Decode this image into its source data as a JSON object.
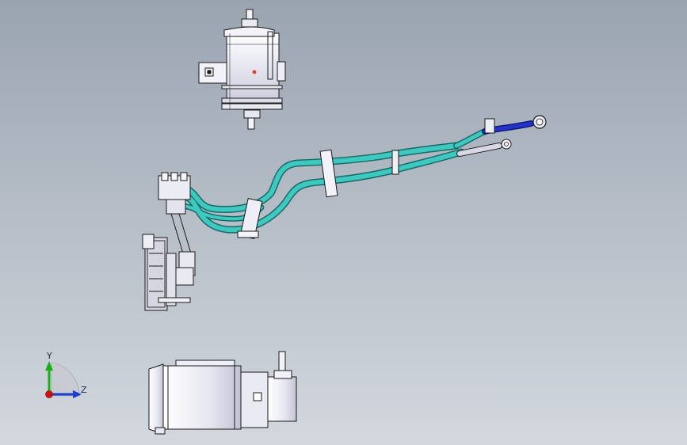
{
  "viewport": {
    "background_top": "#9aa4b1",
    "background_bottom": "#d3d8de"
  },
  "triad": {
    "y_label": "Y",
    "z_label": "Z",
    "x_axis_color": "#d01010",
    "y_axis_color": "#18b018",
    "z_axis_color": "#1a3ccf"
  },
  "colors": {
    "hose": "#3ec8c0",
    "hose_edge": "#166a66",
    "blue_hose": "#2432c8",
    "part_fill": "#f2f2f6",
    "part_shade": "#c9c9dc",
    "outline": "#1a1a1a",
    "accent_dot": "#e04020"
  },
  "icons": [
    "coordinate-triad-icon"
  ]
}
